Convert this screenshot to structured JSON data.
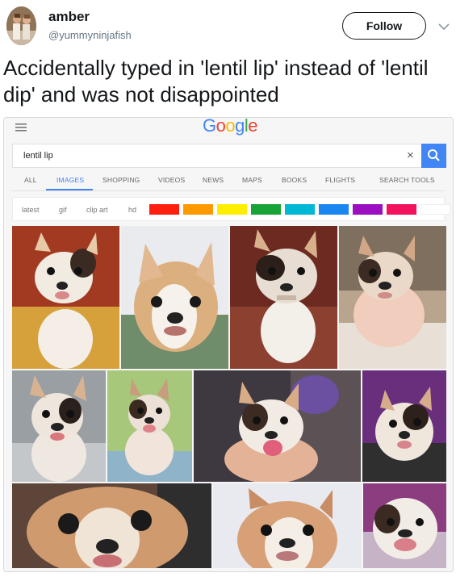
{
  "tweet": {
    "author_name": "amber",
    "author_handle": "@yummyninjafish",
    "follow_label": "Follow",
    "text": "Accidentally typed in 'lentil lip' instead of 'lentil dip' and was not disappointed"
  },
  "google": {
    "logo": "Google",
    "query": "lentil lip",
    "clear_label": "×",
    "tabs": [
      {
        "label": "ALL"
      },
      {
        "label": "IMAGES",
        "active": true
      },
      {
        "label": "SHOPPING"
      },
      {
        "label": "VIDEOS"
      },
      {
        "label": "NEWS"
      },
      {
        "label": "MAPS"
      },
      {
        "label": "BOOKS"
      },
      {
        "label": "FLIGHTS"
      },
      {
        "label": "SEARCH TOOLS"
      }
    ],
    "filters": [
      {
        "label": "latest"
      },
      {
        "label": "gif"
      },
      {
        "label": "clip art"
      },
      {
        "label": "hd"
      }
    ],
    "color_swatches": [
      "#ff1f0f",
      "#ff9900",
      "#ffee00",
      "#17a336",
      "#00b8d6",
      "#1a86f0",
      "#9b0fc0",
      "#f2125e",
      "#ffffff"
    ]
  },
  "colors": {
    "google_blue": "#4285f4",
    "follow_border": "#14171a",
    "handle_gray": "#657786"
  },
  "icons": {
    "menu": "hamburger-icon",
    "caret": "chevron-down-icon",
    "clear": "close-icon",
    "search": "search-icon"
  }
}
